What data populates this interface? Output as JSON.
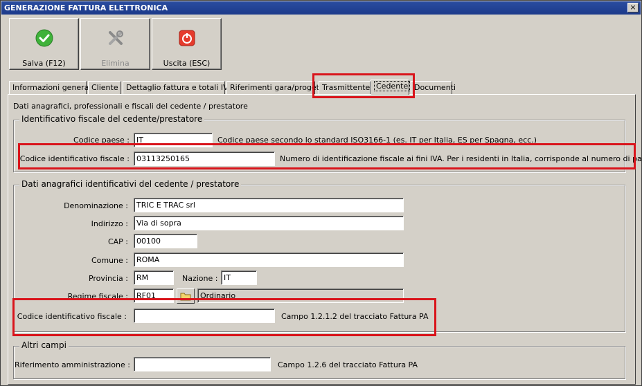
{
  "window": {
    "title": "GENERAZIONE FATTURA ELETTRONICA",
    "close": "×"
  },
  "toolbar": {
    "save": "Salva (F12)",
    "delete": "Elimina",
    "exit": "Uscita (ESC)"
  },
  "tabs": [
    "Informazioni generali",
    "Cliente",
    "Dettaglio fattura e totali IVA",
    "Riferimenti gara/progetto",
    "Trasmittente",
    "Cedente",
    "Documenti"
  ],
  "panel": {
    "intro": "Dati anagrafici, professionali e fiscali del cedente / prestatore",
    "id_fiscale": {
      "title": "Identificativo fiscale del cedente/prestatore",
      "codice_paese_label": "Codice paese :",
      "codice_paese_value": "IT",
      "codice_paese_hint": "Codice paese secondo lo standard ISO3166-1 (es. IT per Italia, ES per Spagna, ecc.)",
      "codice_id_label": "Codice identificativo fiscale :",
      "codice_id_value": "03113250165",
      "codice_id_hint": "Numero di identificazione fiscale ai fini IVA. Per i residenti in Italia, corrisponde al numero di partita IVA"
    },
    "anagrafici": {
      "title": "Dati anagrafici identificativi del cedente / prestatore",
      "denominazione_label": "Denominazione :",
      "denominazione_value": "TRIC E TRAC srl",
      "indirizzo_label": "Indirizzo :",
      "indirizzo_value": "Via di sopra",
      "cap_label": "CAP :",
      "cap_value": "00100",
      "comune_label": "Comune :",
      "comune_value": "ROMA",
      "provincia_label": "Provincia :",
      "provincia_value": "RM",
      "nazione_label": "Nazione :",
      "nazione_value": "IT",
      "regime_label": "Regime fiscale :",
      "regime_value": "RF01",
      "regime_desc": "Ordinario",
      "codice_id_label": "Codice identificativo fiscale :",
      "codice_id_value": "",
      "codice_id_hint": "Campo 1.2.1.2 del tracciato Fattura PA"
    },
    "altri": {
      "title": "Altri campi",
      "rif_label": "Riferimento amministrazione :",
      "rif_value": "",
      "rif_hint": "Campo 1.2.6 del tracciato Fattura PA"
    }
  },
  "colors": {
    "highlight": "#d9141b",
    "title_bar": "#1c3a8a"
  }
}
